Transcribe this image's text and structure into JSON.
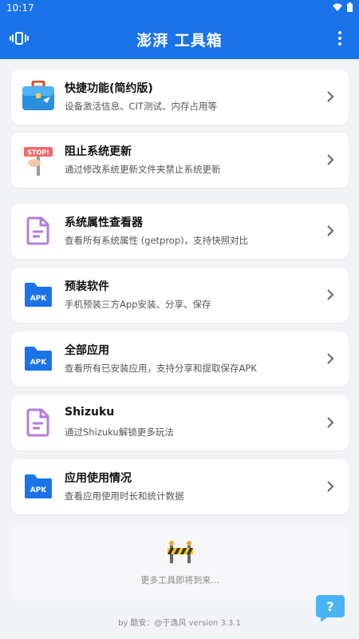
{
  "status": {
    "time": "10:17"
  },
  "appbar": {
    "title": "澎湃 工具箱"
  },
  "items": [
    {
      "title": "快捷功能(简约版)",
      "subtitle": "设备激活信息、CIT测试、内存占用等",
      "icon": "briefcase-icon"
    },
    {
      "title": "阻止系统更新",
      "subtitle": "通过修改系统更新文件夹禁止系统更新",
      "icon": "stop-sign-icon",
      "icon_text": "STOP!"
    },
    {
      "title": "系统属性查看器",
      "subtitle": "查看所有系统属性 (getprop)，支持快照对比",
      "icon": "document-icon"
    },
    {
      "title": "预装软件",
      "subtitle": "手机预装三方App安装、分享、保存",
      "icon": "apk-folder-icon",
      "icon_text": "APK"
    },
    {
      "title": "全部应用",
      "subtitle": "查看所有已安装应用，支持分享和提取保存APK",
      "icon": "apk-folder-icon",
      "icon_text": "APK"
    },
    {
      "title": "Shizuku",
      "subtitle": "通过Shizuku解锁更多玩法",
      "icon": "document-icon"
    },
    {
      "title": "应用使用情况",
      "subtitle": "查看应用使用时长和统计数据",
      "icon": "apk-folder-icon",
      "icon_text": "APK"
    }
  ],
  "footer_card": {
    "text": "更多工具即将到来...",
    "icon": "construction-barrier-icon"
  },
  "byline": "by 酷安：@于逸风 version 3.3.1",
  "help": {
    "icon": "help-chat-icon",
    "label": "?"
  },
  "colors": {
    "primary": "#1a73e8",
    "doc_purple": "#b57be0",
    "folder_blue": "#1a73e8"
  }
}
